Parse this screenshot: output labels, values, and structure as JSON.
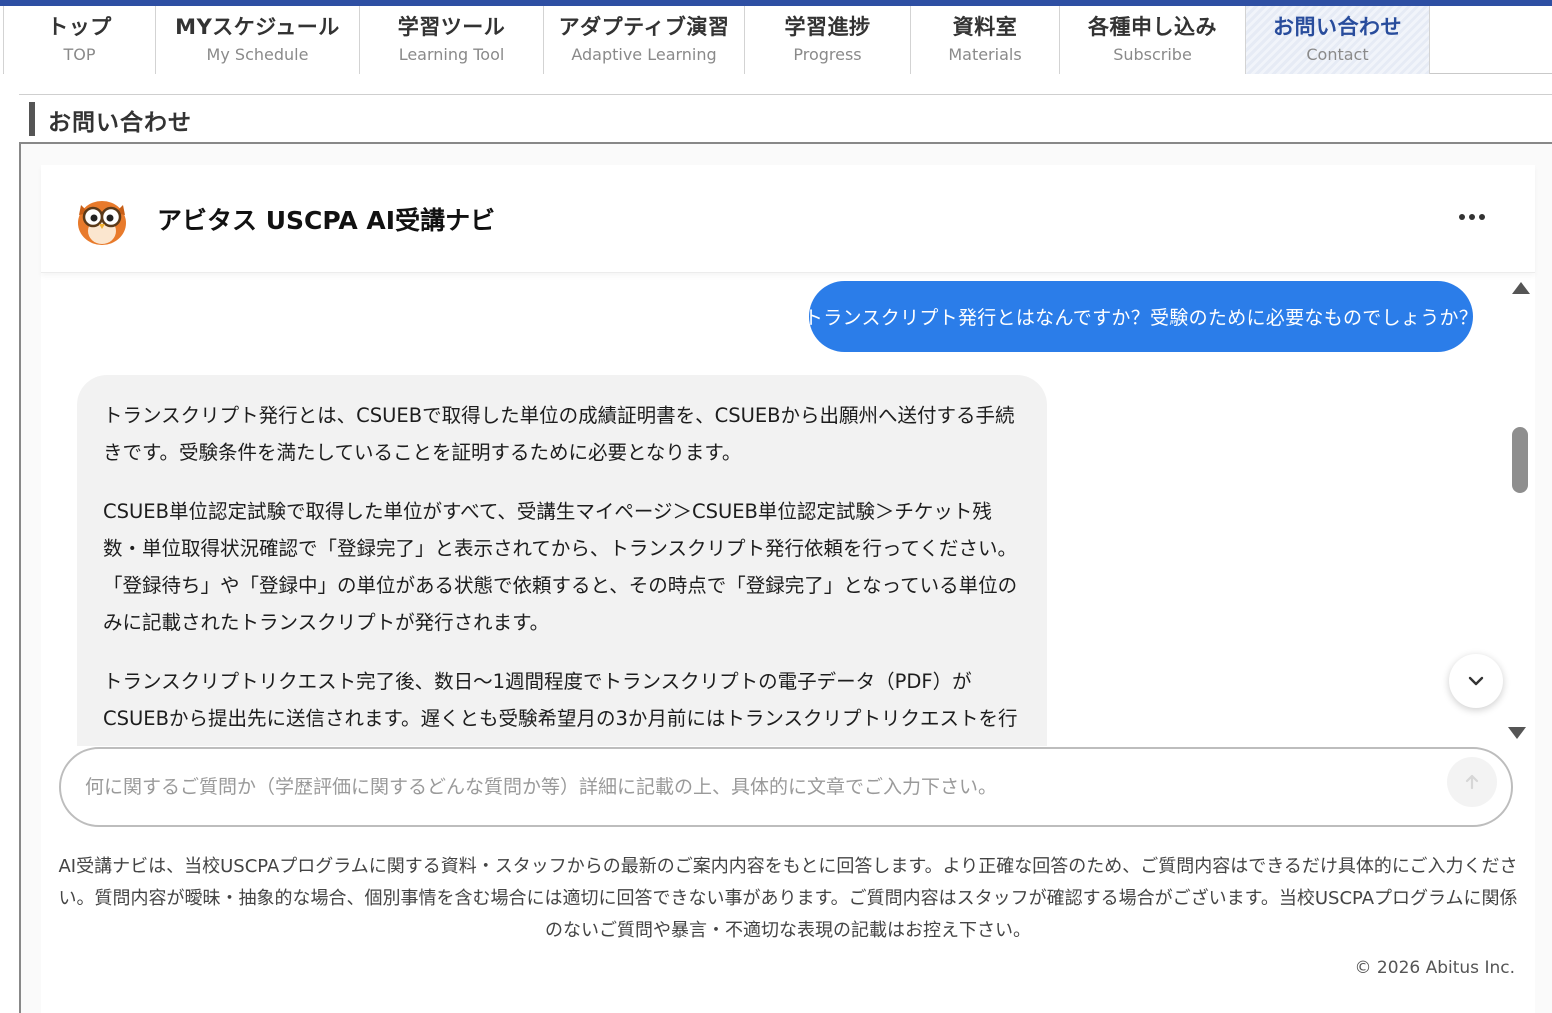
{
  "nav": {
    "tabs": [
      {
        "jp": "トップ",
        "en": "TOP"
      },
      {
        "jp": "MYスケジュール",
        "en": "My Schedule"
      },
      {
        "jp": "学習ツール",
        "en": "Learning Tool"
      },
      {
        "jp": "アダプティブ演習",
        "en": "Adaptive Learning"
      },
      {
        "jp": "学習進捗",
        "en": "Progress"
      },
      {
        "jp": "資料室",
        "en": "Materials"
      },
      {
        "jp": "各種申し込み",
        "en": "Subscribe"
      },
      {
        "jp": "お問い合わせ",
        "en": "Contact"
      }
    ],
    "active_index": 7
  },
  "section": {
    "title": "お問い合わせ"
  },
  "chat": {
    "title": "アビタス USCPA AI受講ナビ",
    "mascot_icon": "owl-mascot-icon",
    "more_icon": "more-dots-icon",
    "user_message": "トランスクリプト発行とはなんですか？受験のために必要なものでしょうか？",
    "bot_paragraphs": [
      "トランスクリプト発行とは、CSUEBで取得した単位の成績証明書を、CSUEBから出願州へ送付する手続きです。受験条件を満たしていることを証明するために必要となります。",
      "CSUEB単位認定試験で取得した単位がすべて、受講生マイページ＞CSUEB単位認定試験＞チケット残数・単位取得状況確認で「登録完了」と表示されてから、トランスクリプト発行依頼を行ってください。「登録待ち」や「登録中」の単位がある状態で依頼すると、その時点で「登録完了」となっている単位のみに記載されたトランスクリプトが発行されます。",
      "トランスクリプトリクエスト完了後、数日〜1週間程度でトランスクリプトの電子データ（PDF）がCSUEBから提出先に送信されます。遅くとも受験希望月の3か月前にはトランスクリプトリクエストを行うことをおすすめします。"
    ],
    "input_placeholder": "何に関するご質問か（学歴評価に関するどんな質問か等）詳細に記載の上、具体的に文章でご入力下さい。",
    "input_value": "",
    "disclaimer": "AI受講ナビは、当校USCPAプログラムに関する資料・スタッフからの最新のご案内内容をもとに回答します。より正確な回答のため、ご質問内容はできるだけ具体的にご入力ください。質問内容が曖昧・抽象的な場合、個別事情を含む場合には適切に回答できない事があります。ご質問内容はスタッフが確認する場合がございます。当校USCPAプログラムに関係のないご質問や暴言・不適切な表現の記載はお控え下さい。",
    "copyright": "© 2026 Abitus Inc."
  },
  "colors": {
    "brand_bar": "#2e4fa3",
    "active_tab_text": "#284c9c",
    "user_bubble": "#2b7de9",
    "bot_bubble": "#f2f2f2"
  }
}
